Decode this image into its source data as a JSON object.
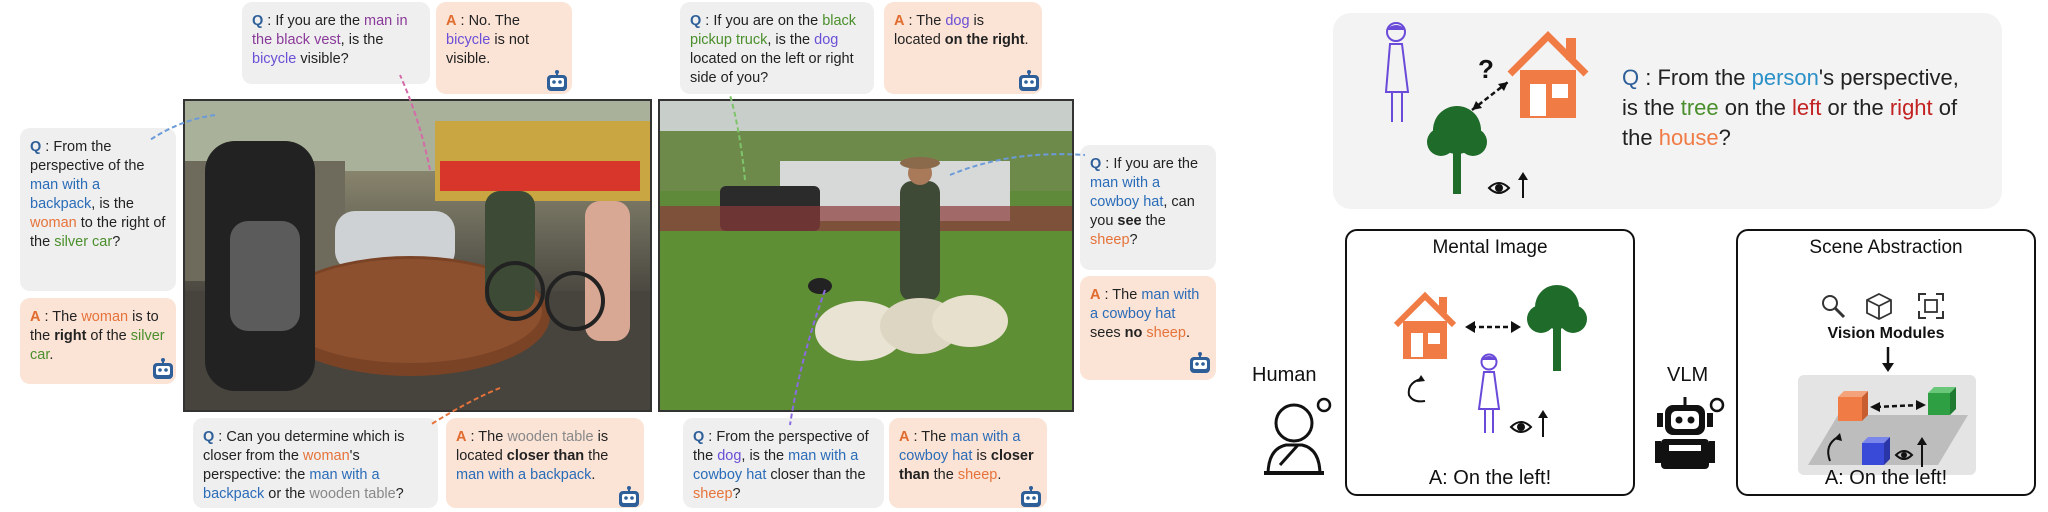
{
  "colors": {
    "question_tag": "#2e5f99",
    "answer_tag": "#e06b2c",
    "person": "#2a6cb8",
    "object_orange": "#e6733a",
    "object_green": "#4a8f2b",
    "object_purple": "#8a3a9a",
    "object_violet": "#6b4fd6",
    "house": "#f07b45",
    "tree": "#1e6b2a",
    "human_figure": "#6a4ad9"
  },
  "icons": [
    "robot-icon",
    "house-icon",
    "tree-icon",
    "person-icon",
    "eye-icon",
    "rotate-arrow-icon",
    "magnifier-icon",
    "cube-icon",
    "scan-icon",
    "human-thinking-icon",
    "vlm-robot-icon"
  ],
  "q1": {
    "tag": "Q",
    "p1": " : If you are the ",
    "h1": "man in the black vest",
    "p2": ", is the ",
    "h2": "bicycle",
    "p3": " visible?"
  },
  "a1": {
    "tag": "A",
    "p1": " : No. The ",
    "h1": "bicycle",
    "p2": " is not visible."
  },
  "q2": {
    "tag": "Q",
    "p1": " : From the perspective of the ",
    "h1": "man with a backpack",
    "p2": ", is the ",
    "h2": "woman",
    "p3": " to the ",
    "b1": "right",
    "p4": " of the ",
    "h3": "silver car",
    "p5": "?"
  },
  "a2": {
    "tag": "A",
    "p1": " : The ",
    "h1": "woman",
    "p2": " is to the ",
    "b1": "right",
    "p3": " of the ",
    "h2": "silver car",
    "p4": "."
  },
  "q3": {
    "tag": "Q",
    "p1": " : Can you determine which is closer from the ",
    "h1": "woman",
    "p2": "'s perspective: the ",
    "h2": "man with a backpack",
    "p3": " or the ",
    "h3": "wooden table",
    "p4": "?"
  },
  "a3": {
    "tag": "A",
    "p1": " : The ",
    "h1": "wooden table",
    "p2": " is located ",
    "b1": "closer than",
    "p3": " the ",
    "h2": "man with a backpack",
    "p4": "."
  },
  "q4": {
    "tag": "Q",
    "p1": " : If you are on the ",
    "h1": "black pickup truck",
    "p2": ", is the ",
    "h2": "dog",
    "p3": " located on the left or right side of you?"
  },
  "a4": {
    "tag": "A",
    "p1": " : The ",
    "h1": "dog",
    "p2": " is located ",
    "b1": "on the right",
    "p3": "."
  },
  "q5": {
    "tag": "Q",
    "p1": " : If you are the ",
    "h1": "man with a cowboy hat",
    "p2": ", can you ",
    "b1": "see",
    "p3": " the ",
    "h2": "sheep",
    "p4": "?"
  },
  "a5": {
    "tag": "A",
    "p1": " : The ",
    "h1": "man with a cowboy hat",
    "p2": " sees ",
    "b1": "no",
    "p3": " ",
    "h2": "sheep",
    "p4": "."
  },
  "q6": {
    "tag": "Q",
    "p1": " : From the perspective of the ",
    "h1": "dog",
    "p2": ", is the ",
    "h2": "man with a cowboy hat",
    "p3": " closer than the ",
    "h3": "sheep",
    "p4": "?"
  },
  "a6": {
    "tag": "A",
    "p1": " : The ",
    "h1": "man with a cowboy hat",
    "p2": " is ",
    "b1": "closer than",
    "p3": " the ",
    "h2": "sheep",
    "p4": "."
  },
  "diagram": {
    "question": {
      "tag": "Q",
      "p1": " : From the ",
      "h1": "person",
      "p2": "'s perspective, is the ",
      "h2": "tree",
      "p3": " on the ",
      "h3": "left",
      "p4": " or the ",
      "h4": "right",
      "p5": " of the ",
      "h5": "house",
      "p6": "?"
    },
    "question_mark": "?",
    "mental_image_title": "Mental Image",
    "scene_abstraction_title": "Scene Abstraction",
    "vision_modules_label": "Vision Modules",
    "human_label": "Human",
    "vlm_label": "VLM",
    "answer_mental": "A: On the left!",
    "answer_scene": "A: On the left!"
  }
}
